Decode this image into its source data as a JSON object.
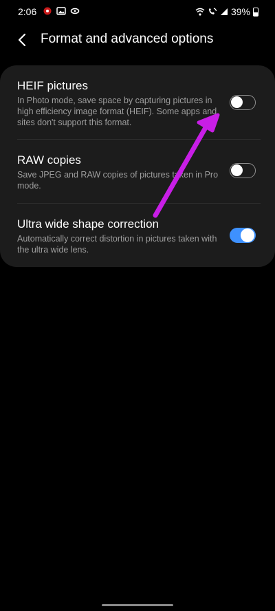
{
  "status_bar": {
    "time": "2:06",
    "battery_percent": "39%",
    "left_icons": [
      "notification-app-icon",
      "gallery-icon",
      "sync-icon"
    ],
    "right_icons": [
      "wifi-icon",
      "wifi-calling-icon",
      "signal-icon",
      "battery-icon"
    ]
  },
  "header": {
    "title": "Format and advanced options",
    "back_icon": "chevron-left-icon"
  },
  "settings": [
    {
      "title": "HEIF pictures",
      "description": "In Photo mode, save space by capturing pictures in high efficiency image format (HEIF). Some apps and sites don't support this format.",
      "enabled": false
    },
    {
      "title": "RAW copies",
      "description": "Save JPEG and RAW copies of pictures taken in Pro mode.",
      "enabled": false
    },
    {
      "title": "Ultra wide shape correction",
      "description": "Automatically correct distortion in pictures taken with the ultra wide lens.",
      "enabled": true
    }
  ],
  "colors": {
    "background": "#000000",
    "card": "#1c1c1c",
    "accent": "#3e91ff",
    "annotation_arrow": "#c81ee6"
  }
}
